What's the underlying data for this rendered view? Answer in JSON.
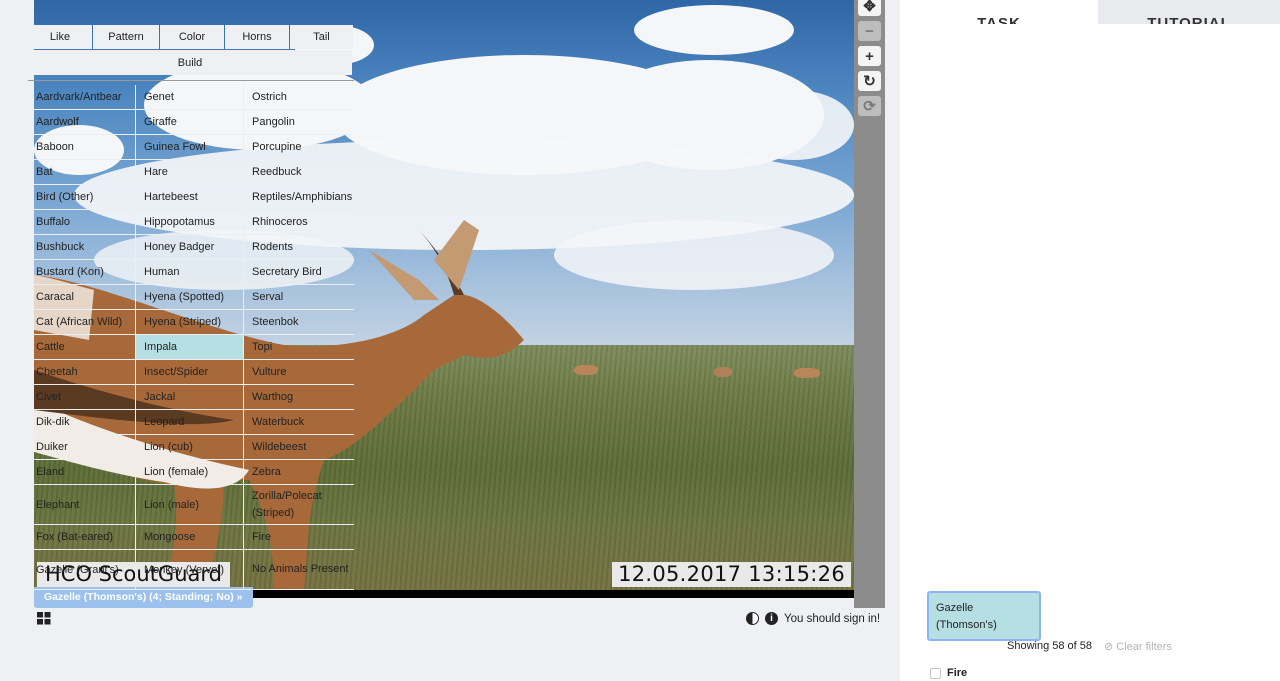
{
  "viewer": {
    "camera_caption": "HCO ScoutGuard",
    "timestamp_caption": "12.05.2017  13:15:26",
    "tag_chip": "Gazelle (Thomson's) (4; Standing; No)  »",
    "controls": [
      "move-icon",
      "zoom-out-icon",
      "zoom-in-icon",
      "rotate-icon",
      "reset-icon"
    ],
    "signin_text": "You should sign in!"
  },
  "panel": {
    "tabs": [
      {
        "label": "TASK"
      },
      {
        "label": "TUTORIAL"
      }
    ],
    "filters": [
      "Like",
      "Pattern",
      "Color",
      "Horns",
      "Tail"
    ],
    "filter_build": "Build",
    "species_rows": [
      [
        "Aardvark/Antbear",
        "Genet",
        "Ostrich"
      ],
      [
        "Aardwolf",
        "Giraffe",
        "Pangolin"
      ],
      [
        "Baboon",
        "Guinea Fowl",
        "Porcupine"
      ],
      [
        "Bat",
        "Hare",
        "Reedbuck"
      ],
      [
        "Bird (Other)",
        "Hartebeest",
        "Reptiles/Amphibians"
      ],
      [
        "Buffalo",
        "Hippopotamus",
        "Rhinoceros"
      ],
      [
        "Bushbuck",
        "Honey Badger",
        "Rodents"
      ],
      [
        "Bustard (Kori)",
        "Human",
        "Secretary Bird"
      ],
      [
        "Caracal",
        "Hyena (Spotted)",
        "Serval"
      ],
      [
        "Cat (African Wild)",
        "Hyena (Striped)",
        "Steenbok"
      ],
      [
        "Cattle",
        "Impala",
        "Topi"
      ],
      [
        "Cheetah",
        "Insect/Spider",
        "Vulture"
      ],
      [
        "Civet",
        "Jackal",
        "Warthog"
      ],
      [
        "Dik-dik",
        "Leopard",
        "Waterbuck"
      ],
      [
        "Duiker",
        "Lion (cub)",
        "Wildebeest"
      ],
      [
        "Eland",
        "Lion (female)",
        "Zebra"
      ],
      [
        "Elephant",
        "Lion (male)",
        "Zorilla/Polecat (Striped)"
      ],
      [
        "Fox (Bat-eared)",
        "Mongoose",
        "Fire"
      ],
      [
        "Gazelle (Grant's)",
        "Monkey (Vervet)",
        "No Animals Present"
      ]
    ],
    "selected_species": "Gazelle (Thomson's)",
    "showing": "Showing 58 of 58",
    "clear_filters": "Clear filters",
    "fire_label": "Fire",
    "highlight_color": "#b6dfe3"
  }
}
